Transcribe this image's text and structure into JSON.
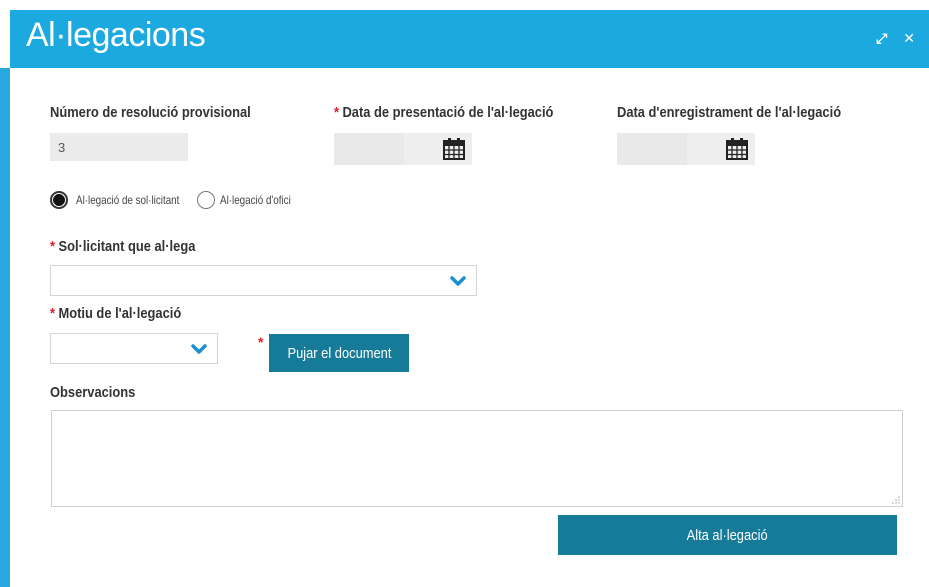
{
  "dialog": {
    "title": "Al·legacions",
    "icons": [
      "expand-icon",
      "close-icon"
    ]
  },
  "fields": {
    "resolution_number": {
      "label": "Número de resolució provisional",
      "value": "3"
    },
    "presentation_date": {
      "label": "Data de presentació de l'al·legació",
      "required": true
    },
    "registration_date": {
      "label": "Data d'enregistrament de l'al·legació"
    }
  },
  "radios": [
    {
      "label": "Al·legació de sol·licitant",
      "selected": true
    },
    {
      "label": "Al·legació d'ofici",
      "selected": false
    }
  ],
  "applicant": {
    "label": "Sol·licitant que al·lega",
    "required": true,
    "value": ""
  },
  "reason": {
    "label": "Motiu de l'al·legació",
    "required": true,
    "value": ""
  },
  "upload_button": {
    "label": "Pujar el document",
    "required": true
  },
  "observations": {
    "label": "Observacions",
    "value": ""
  },
  "submit_button": {
    "label": "Alta al·legació"
  },
  "colors": {
    "titlebar": "#1ba9e0",
    "button": "#167b98",
    "required_marker": "#e0202a",
    "chevron": "#1b8fd0"
  }
}
